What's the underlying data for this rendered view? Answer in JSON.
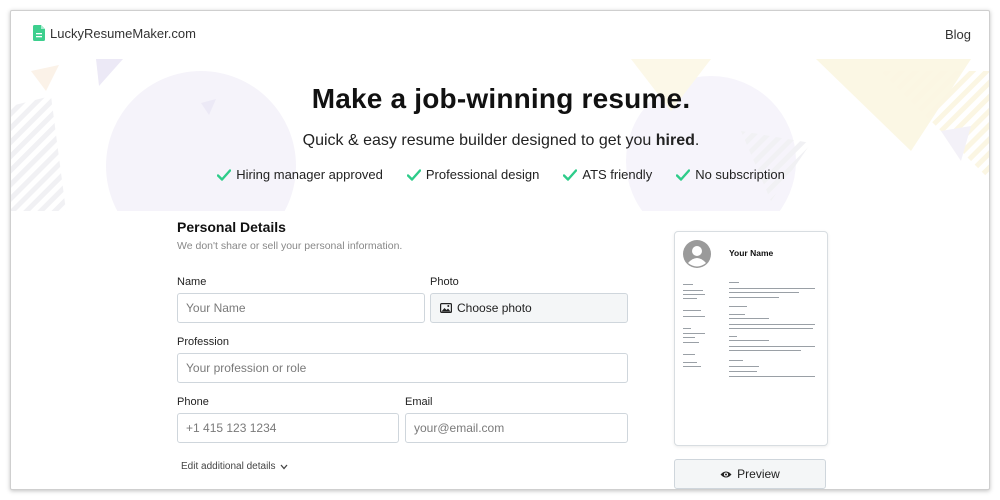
{
  "header": {
    "logo_text": "LuckyResumeMaker.com",
    "blog_label": "Blog"
  },
  "hero": {
    "title": "Make a job-winning resume.",
    "subtitle_prefix": "Quick & easy resume builder designed to get you ",
    "subtitle_bold": "hired",
    "subtitle_suffix": ".",
    "features": [
      "Hiring manager approved",
      "Professional design",
      "ATS friendly",
      "No subscription"
    ]
  },
  "form": {
    "section_title": "Personal Details",
    "section_note": "We don't share or sell your personal information.",
    "name": {
      "label": "Name",
      "value": "",
      "placeholder": "Your Name"
    },
    "photo": {
      "label": "Photo",
      "button_label": "Choose photo"
    },
    "profession": {
      "label": "Profession",
      "value": "",
      "placeholder": "Your profession or role"
    },
    "phone": {
      "label": "Phone",
      "value": "",
      "placeholder": "+1 415 123 1234"
    },
    "email": {
      "label": "Email",
      "value": "",
      "placeholder": "your@email.com"
    },
    "edit_details_label": "Edit additional details"
  },
  "preview": {
    "name": "Your Name",
    "button_label": "Preview"
  },
  "colors": {
    "accent_green": "#2ecc8a",
    "logo_green": "#3dcf8e",
    "input_border": "#cfd6dc",
    "button_bg": "#f4f6f7"
  }
}
